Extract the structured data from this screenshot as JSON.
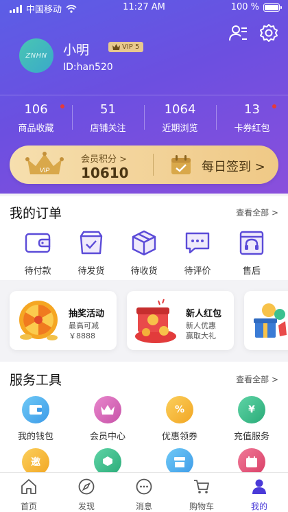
{
  "status_bar": {
    "carrier": "中国移动",
    "time": "11:27 AM",
    "battery": "100 %"
  },
  "profile": {
    "avatar_text": "ZNHN",
    "name": "小明",
    "vip_badge": "VIP 5",
    "id_text": "ID:han520"
  },
  "stats": [
    {
      "value": "106",
      "label": "商品收藏",
      "dot": true
    },
    {
      "value": "51",
      "label": "店铺关注",
      "dot": false
    },
    {
      "value": "1064",
      "label": "近期浏览",
      "dot": false
    },
    {
      "value": "13",
      "label": "卡券红包",
      "dot": true
    }
  ],
  "member": {
    "points_label": "会员积分 >",
    "points": "10610",
    "vip_text": "VIP",
    "signin": "每日签到 >"
  },
  "orders": {
    "title": "我的订单",
    "more": "查看全部 >",
    "items": [
      {
        "label": "待付款",
        "icon": "wallet-icon"
      },
      {
        "label": "待发货",
        "icon": "shop-bag-icon"
      },
      {
        "label": "待收货",
        "icon": "box-icon"
      },
      {
        "label": "待评价",
        "icon": "chat-icon"
      },
      {
        "label": "售后",
        "icon": "headset-icon"
      }
    ]
  },
  "promos": [
    {
      "title": "抽奖活动",
      "sub1": "最高可减",
      "sub2": "￥8888",
      "icon": "lottery-wheel-icon"
    },
    {
      "title": "新人红包",
      "sub1": "新人优惠",
      "sub2": "赢取大礼",
      "icon": "red-envelope-icon"
    }
  ],
  "services": {
    "title": "服务工具",
    "more": "查看全部 >",
    "items": [
      {
        "label": "我的钱包",
        "icon": "wallet-icon",
        "color": "#4fb3f0",
        "glyph": ""
      },
      {
        "label": "会员中心",
        "icon": "crown-icon",
        "color": "#d767b8",
        "glyph": ""
      },
      {
        "label": "优惠领券",
        "icon": "coupon-icon",
        "color": "#f5b63a",
        "glyph": "%"
      },
      {
        "label": "充值服务",
        "icon": "phone-yen-icon",
        "color": "#3cc08f",
        "glyph": "¥"
      },
      {
        "label": "",
        "icon": "invite-icon",
        "color": "#f5b63a",
        "glyph": "邀"
      },
      {
        "label": "",
        "icon": "hand-box-icon",
        "color": "#3cc08f",
        "glyph": ""
      },
      {
        "label": "",
        "icon": "store-icon",
        "color": "#4fb3f0",
        "glyph": ""
      },
      {
        "label": "",
        "icon": "calendar-icon",
        "color": "#e9577a",
        "glyph": ""
      }
    ]
  },
  "tabs": [
    {
      "label": "首页",
      "icon": "home-icon",
      "active": false
    },
    {
      "label": "发现",
      "icon": "compass-icon",
      "active": false
    },
    {
      "label": "消息",
      "icon": "message-icon",
      "active": false
    },
    {
      "label": "购物车",
      "icon": "cart-icon",
      "active": false
    },
    {
      "label": "我的",
      "icon": "user-icon",
      "active": true
    }
  ],
  "colors": {
    "accent": "#4a3ad8",
    "header_start": "#5b5ee6",
    "header_end": "#8a4fdc",
    "gold": "#f2d196",
    "red_dot": "#e63a3a"
  }
}
